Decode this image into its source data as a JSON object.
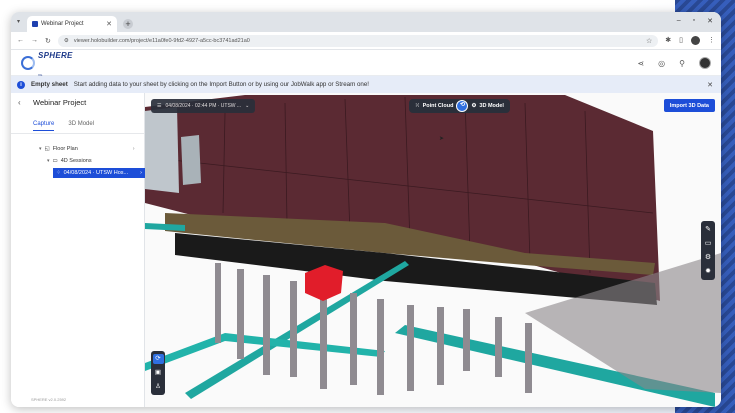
{
  "browser": {
    "tab_title": "Webinar Project",
    "new_tab": "+",
    "url": "viewer.holobuilder.com/project/e11a0fe0-9fd2-4927-a5cc-bc3741ad21a0",
    "window_controls": [
      "–",
      "▫",
      "✕"
    ]
  },
  "header": {
    "logo_text": "SPHERE",
    "logo_sub": "XG"
  },
  "banner": {
    "title": "Empty sheet",
    "message": "Start adding data to your sheet by clicking on the Import Button or by using our JobWalk app or Stream one!"
  },
  "sidebar": {
    "project_title": "Webinar Project",
    "tabs": [
      {
        "label": "Capture",
        "active": true
      },
      {
        "label": "3D Model",
        "active": false
      }
    ],
    "tree": {
      "floor_plan": "Floor Plan",
      "sessions_folder": "4D Sessions",
      "selected_session": "04/08/2024 · UTSW Hos..."
    },
    "version": "SPHERE v2.0.2592"
  },
  "viewer": {
    "session_label": "04/08/2024 · 02:44 PM · UTSW ...",
    "mode_left": "Point Cloud",
    "mode_right": "3D Model",
    "import_button": "Import 3D Data"
  },
  "colors": {
    "accent": "#1d4ed8",
    "facade": "#5b2a33",
    "beam": "#1fa7a0",
    "highlight": "#e11d2a"
  }
}
